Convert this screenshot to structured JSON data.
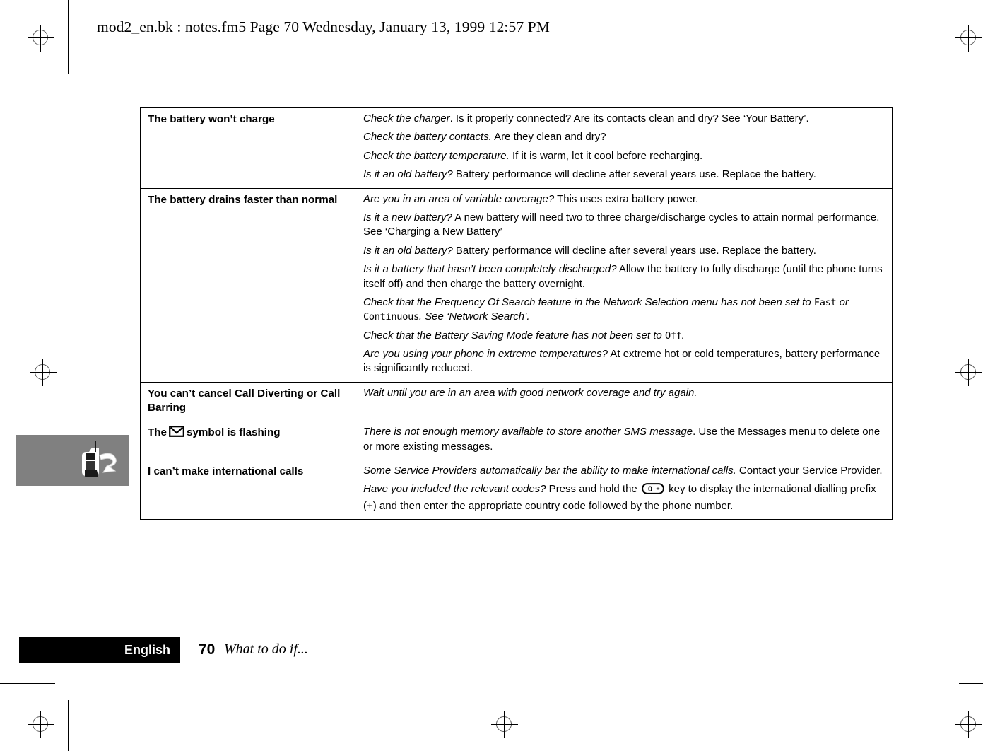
{
  "header": {
    "text": "mod2_en.bk : notes.fm5  Page 70  Wednesday, January 13, 1999  12:57 PM"
  },
  "margin_graphic": {
    "label": "phone-question-illustration",
    "background_color": "#808080"
  },
  "table": {
    "rows": [
      {
        "symptom": "The battery won’t charge",
        "symptom_has_icon": false,
        "actions": [
          {
            "lead": "Check the charger",
            "lead_suffix": ".",
            "body": " Is it properly connected? Are its contacts clean and dry? See ‘Your Battery’."
          },
          {
            "lead": "Check the battery contacts.",
            "lead_suffix": "",
            "body": " Are they clean and dry?"
          },
          {
            "lead": "Check the battery temperature.",
            "lead_suffix": "",
            "body": " If it is warm, let it cool before recharging."
          },
          {
            "lead": "Is it an old battery?",
            "lead_suffix": "",
            "body": " Battery performance will decline after several years use. Replace the battery."
          }
        ]
      },
      {
        "symptom": "The battery drains faster than normal",
        "symptom_has_icon": false,
        "actions": [
          {
            "lead": "Are you in an area of variable coverage?",
            "lead_suffix": "",
            "body": " This uses extra battery power."
          },
          {
            "lead": "Is it a new battery?",
            "lead_suffix": "",
            "body": " A new battery will need two to three charge/discharge cycles to attain normal performance. See ‘Charging a New Battery’"
          },
          {
            "lead": "Is it an old battery?",
            "lead_suffix": "",
            "body": " Battery performance will decline after several years use. Replace the battery."
          },
          {
            "lead": "Is it a battery that hasn’t been completely discharged?",
            "lead_suffix": "",
            "body": " Allow the battery to fully discharge (until the phone turns itself off) and then charge the battery overnight."
          },
          {
            "lead": "Check that the Frequency Of Search feature in the Network Selection menu has not been set to ",
            "lead_suffix": "",
            "lcd_1": "Fast",
            "mid": " or ",
            "lcd_2": "Continuous",
            "tail": ". See ‘Network Search’.",
            "body": ""
          },
          {
            "lead": "Check that the Battery Saving Mode feature has not been set to ",
            "lead_suffix": "",
            "lcd_1": "Off",
            "tail": ".",
            "body": ""
          },
          {
            "lead": "Are you using your phone in extreme temperatures?",
            "lead_suffix": "",
            "body": " At extreme hot or cold temperatures, battery performance is significantly reduced."
          }
        ]
      },
      {
        "symptom": "You can’t cancel Call Diverting or Call Barring",
        "symptom_has_icon": false,
        "actions": [
          {
            "lead": "Wait until you are in an area with good network coverage and try again.",
            "lead_suffix": "",
            "body": ""
          }
        ]
      },
      {
        "symptom_prefix": "The",
        "symptom_suffix": "symbol is flashing",
        "symptom": "The  symbol is flashing",
        "symptom_has_icon": true,
        "icon_name": "envelope-icon",
        "actions": [
          {
            "lead": "There is not enough memory available to store another SMS message",
            "lead_suffix": ".",
            "body": " Use the Messages menu to delete one or more existing messages."
          }
        ]
      },
      {
        "symptom": "I can’t make international calls",
        "symptom_has_icon": false,
        "actions": [
          {
            "lead": "Some Service Providers automatically bar the ability to make international calls.",
            "lead_suffix": "",
            "body": " Contact your Service Provider."
          },
          {
            "lead": "Have you included the relevant codes?",
            "lead_suffix": "",
            "body_pre": " Press and hold the ",
            "key_label": "0",
            "key_plus": "+",
            "body_post": " key to display the international dialling prefix (+) and then enter the appropriate country code followed by the phone number.",
            "body": ""
          }
        ]
      }
    ]
  },
  "footer": {
    "language": "English",
    "page_number": "70",
    "chapter": "What to do if..."
  }
}
